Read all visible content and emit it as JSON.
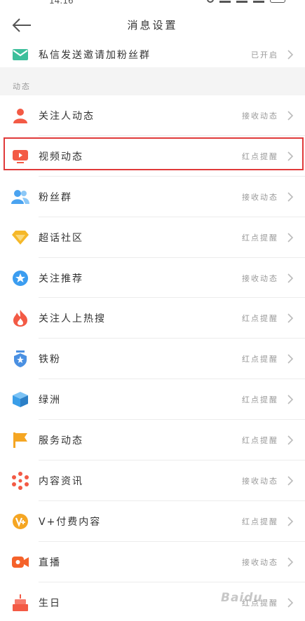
{
  "status_bar": {
    "time": "14:16"
  },
  "nav": {
    "title": "消息设置"
  },
  "top_item": {
    "label": "私信发送邀请加粉丝群",
    "value": "已开启",
    "icon": "envelope-icon"
  },
  "section": {
    "title": "动态"
  },
  "items": [
    {
      "label": "关注人动态",
      "value": "接收动态",
      "icon": "person-icon",
      "color": "#f35a45"
    },
    {
      "label": "视频动态",
      "value": "红点提醒",
      "icon": "video-icon",
      "color": "#f35a45"
    },
    {
      "label": "粉丝群",
      "value": "接收动态",
      "icon": "group-icon",
      "color": "#4aa3f0"
    },
    {
      "label": "超话社区",
      "value": "红点提醒",
      "icon": "diamond-icon",
      "color": "#f5b829"
    },
    {
      "label": "关注推荐",
      "value": "接收动态",
      "icon": "star-badge-icon",
      "color": "#3b9df0"
    },
    {
      "label": "关注人上热搜",
      "value": "红点提醒",
      "icon": "flame-icon",
      "color": "#f35a45"
    },
    {
      "label": "铁粉",
      "value": "红点提醒",
      "icon": "shield-icon",
      "color": "#4a90e2"
    },
    {
      "label": "绿洲",
      "value": "红点提醒",
      "icon": "cube-icon",
      "color": "#3a9ee8"
    },
    {
      "label": "服务动态",
      "value": "红点提醒",
      "icon": "flag-icon",
      "color": "#f5a623"
    },
    {
      "label": "内容资讯",
      "value": "接收动态",
      "icon": "dots-ring-icon",
      "color": "#f35a45"
    },
    {
      "label": "V+付费内容",
      "value": "红点提醒",
      "icon": "vplus-icon",
      "color": "#f5a623"
    },
    {
      "label": "直播",
      "value": "接收动态",
      "icon": "live-camera-icon",
      "color": "#f5622a"
    },
    {
      "label": "生日",
      "value": "红点提醒",
      "icon": "cake-icon",
      "color": "#f35a45"
    }
  ],
  "watermark": {
    "text": "Baidu"
  }
}
